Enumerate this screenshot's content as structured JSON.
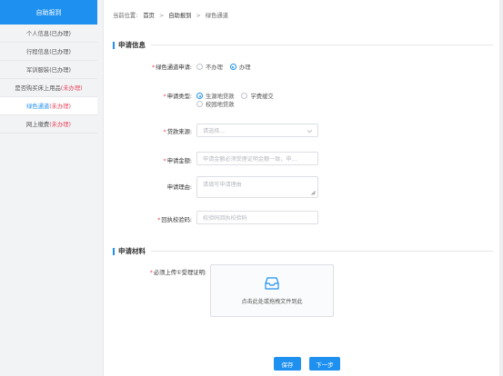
{
  "sidebar": {
    "header": "自助报到",
    "items": [
      {
        "label": "个人信息",
        "status": "(已办理)",
        "warn": false,
        "active": false
      },
      {
        "label": "行程信息",
        "status": "(已办理)",
        "warn": false,
        "active": false
      },
      {
        "label": "军训服装",
        "status": "(已办理)",
        "warn": false,
        "active": false
      },
      {
        "label": "是否购买床上用品",
        "status": "(未办理)",
        "warn": true,
        "active": false
      },
      {
        "label": "绿色通道",
        "status": "(未办理)",
        "warn": true,
        "active": true
      },
      {
        "label": "网上缴费",
        "status": "(未办理)",
        "warn": true,
        "active": false
      }
    ]
  },
  "breadcrumb": {
    "prefix": "当前位置:",
    "items": [
      "首页",
      "自助报到",
      "绿色通道"
    ],
    "separator": ">"
  },
  "section_apply": "申请信息",
  "section_materials": "申请材料",
  "form": {
    "green_channel": {
      "label": "绿色通道申请:",
      "options": [
        "不办理",
        "办理"
      ],
      "selected": "办理"
    },
    "apply_type": {
      "label": "申请类型:",
      "options": [
        "生源地贷款",
        "学费缓交",
        "校园地贷款"
      ],
      "selected": "生源地贷款"
    },
    "loan_source": {
      "label": "贷款来源:",
      "placeholder": "请选择..."
    },
    "amount": {
      "label": "申请金额:",
      "placeholder": "申请金额必须受理证明金额一致，申..."
    },
    "reason": {
      "label": "申请理由:",
      "placeholder": "请填写申请理由"
    },
    "verify_code": {
      "label": "回执校验码:",
      "placeholder": "校验码回执校验码"
    },
    "upload": {
      "label": "必须上传①受理证明:",
      "hint": "点击此处或拖拽文件到此"
    }
  },
  "buttons": {
    "save": "保存",
    "next": "下一步"
  },
  "colors": {
    "primary": "#1e90f0",
    "warn": "#e8495e",
    "sidebar_bg": "#f2f3f5"
  },
  "icons": {
    "upload": "inbox-tray-icon",
    "select": "chevron-down-icon"
  }
}
